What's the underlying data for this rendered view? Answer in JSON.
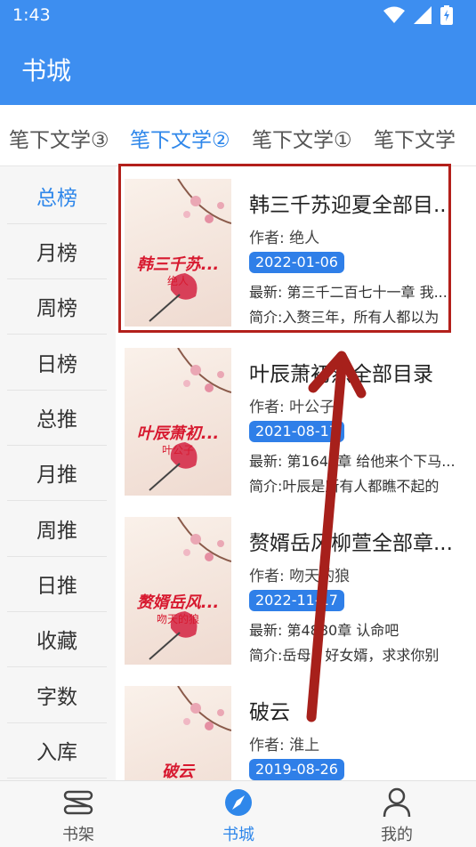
{
  "status_bar": {
    "time": "1:43"
  },
  "app_bar": {
    "title": "书城"
  },
  "tabs": [
    {
      "label": "笔下文学③",
      "active": false
    },
    {
      "label": "笔下文学②",
      "active": true
    },
    {
      "label": "笔下文学①",
      "active": false
    },
    {
      "label": "笔下文学",
      "active": false
    }
  ],
  "ranks": [
    {
      "label": "总榜",
      "active": true
    },
    {
      "label": "月榜",
      "active": false
    },
    {
      "label": "周榜",
      "active": false
    },
    {
      "label": "日榜",
      "active": false
    },
    {
      "label": "总推",
      "active": false
    },
    {
      "label": "月推",
      "active": false
    },
    {
      "label": "周推",
      "active": false
    },
    {
      "label": "日推",
      "active": false
    },
    {
      "label": "收藏",
      "active": false
    },
    {
      "label": "字数",
      "active": false
    },
    {
      "label": "入库",
      "active": false
    }
  ],
  "books": [
    {
      "title": "韩三千苏迎夏全部目...",
      "cover_title": "韩三千苏...",
      "cover_author": "绝人",
      "author": "作者: 绝人",
      "date": "2022-01-06",
      "latest": "最新: 第三千二百七十一章 我...",
      "intro": "简介:入赘三年，所有人都以为"
    },
    {
      "title": "叶辰萧初然全部目录",
      "cover_title": "叶辰萧初...",
      "cover_author": "叶公子",
      "author": "作者: 叶公子",
      "date": "2021-08-17",
      "latest": "最新: 第1642章 给他来个下马...",
      "intro": "简介:叶辰是所有人都瞧不起的"
    },
    {
      "title": "赘婿岳风柳萱全部章...",
      "cover_title": "赘婿岳风...",
      "cover_author": "吻天的狼",
      "author": "作者: 吻天的狼",
      "date": "2022-11-17",
      "latest": "最新: 第4880章 认命吧",
      "intro": "简介:岳母：好女婿，求求你别"
    },
    {
      "title": "破云",
      "cover_title": "破云",
      "cover_author": "淮上",
      "author": "作者: 淮上",
      "date": "2019-08-26",
      "latest": "",
      "intro": ""
    }
  ],
  "bottom_nav": [
    {
      "label": "书架",
      "icon": "bookshelf-icon",
      "active": false
    },
    {
      "label": "书城",
      "icon": "compass-icon",
      "active": true
    },
    {
      "label": "我的",
      "icon": "profile-icon",
      "active": false
    }
  ],
  "colors": {
    "primary": "#3d8ef0",
    "accent": "#2f87ea",
    "date_badge": "#2f7fe8",
    "annotation": "#b3201b"
  }
}
